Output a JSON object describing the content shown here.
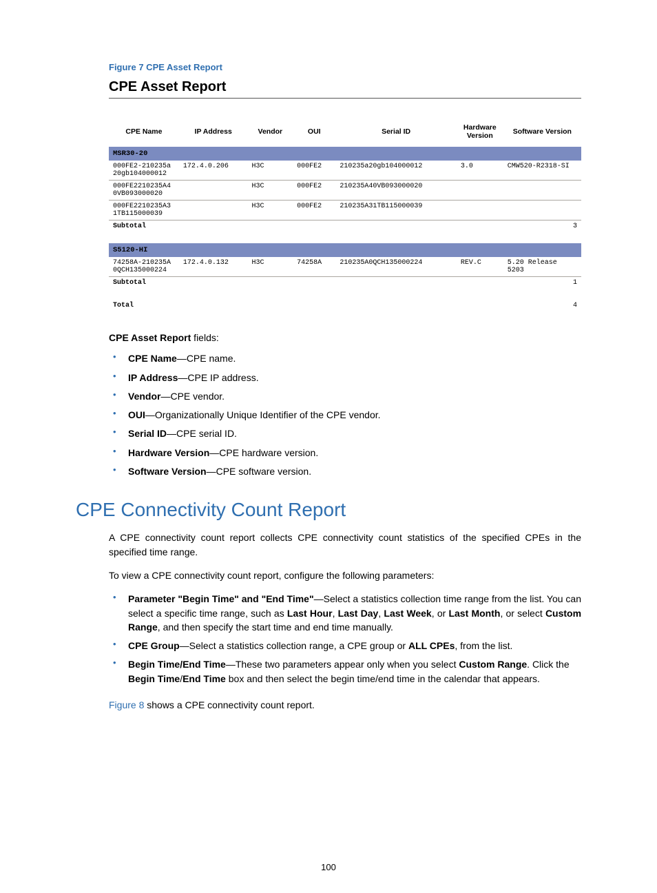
{
  "figure": {
    "caption": "Figure 7 CPE Asset Report"
  },
  "report": {
    "title": "CPE Asset Report",
    "columns": [
      "CPE Name",
      "IP Address",
      "Vendor",
      "OUI",
      "Serial ID",
      "Hardware Version",
      "Software Version"
    ],
    "groups": [
      {
        "name": "MSR30-20",
        "rows": [
          {
            "name": "000FE2-210235a20gb104000012",
            "ip": "172.4.0.206",
            "vendor": "H3C",
            "oui": "000FE2",
            "serial": "210235a20gb104000012",
            "hw": "3.0",
            "sw": "CMW520-R2318-SI"
          },
          {
            "name": "000FE2210235A40VB093000020",
            "ip": "",
            "vendor": "H3C",
            "oui": "000FE2",
            "serial": "210235A40VB093000020",
            "hw": "",
            "sw": ""
          },
          {
            "name": "000FE2210235A31TB115000039",
            "ip": "",
            "vendor": "H3C",
            "oui": "000FE2",
            "serial": "210235A31TB115000039",
            "hw": "",
            "sw": ""
          }
        ],
        "subtotal_label": "Subtotal",
        "subtotal": "3"
      },
      {
        "name": "S5120-HI",
        "rows": [
          {
            "name": "74258A-210235A0QCH135000224",
            "ip": "172.4.0.132",
            "vendor": "H3C",
            "oui": "74258A",
            "serial": "210235A0QCH135000224",
            "hw": "REV.C",
            "sw": "5.20 Release 5203"
          }
        ],
        "subtotal_label": "Subtotal",
        "subtotal": "1"
      }
    ],
    "total_label": "Total",
    "total": "4"
  },
  "fields": {
    "intro_bold": "CPE Asset Report",
    "intro_rest": " fields:",
    "items": [
      {
        "term": "CPE Name",
        "desc": "—CPE name."
      },
      {
        "term": "IP Address",
        "desc": "—CPE IP address."
      },
      {
        "term": "Vendor",
        "desc": "—CPE vendor."
      },
      {
        "term": "OUI",
        "desc": "—Organizationally Unique Identifier of the CPE vendor."
      },
      {
        "term": "Serial ID",
        "desc": "—CPE serial ID."
      },
      {
        "term": "Hardware Version",
        "desc": "—CPE hardware version."
      },
      {
        "term": "Software Version",
        "desc": "—CPE software version."
      }
    ]
  },
  "section": {
    "heading": "CPE Connectivity Count Report",
    "para1": "A CPE connectivity count report collects CPE connectivity count statistics of the specified CPEs in the specified time range.",
    "para2": "To view a CPE connectivity count report, configure the following parameters:",
    "items": [
      {
        "term": "Parameter \"Begin Time\" and \"End Time\"",
        "desc_before": "—Select a statistics collection time range from the list. You can select a specific time range, such as ",
        "bolds": [
          "Last Hour",
          "Last Day",
          "Last Week",
          "Last Month"
        ],
        "join1": ", ",
        "join2": ", ",
        "join3": ", or ",
        "desc_mid": ", or select ",
        "bold_last": "Custom Range",
        "desc_after": ", and then specify the start time and end time manually."
      },
      {
        "term": "CPE Group",
        "desc_before": "—Select a statistics collection range, a CPE group or ",
        "bold_last": "ALL CPEs",
        "desc_after": ", from the list."
      },
      {
        "term": "Begin Time/End Time",
        "desc_before": "—These two parameters appear only when you select ",
        "bold_mid": "Custom Range",
        "desc_mid2": ". Click the ",
        "bold_a": "Begin Time",
        "slash": "/",
        "bold_b": "End Time",
        "desc_after": " box and then select the begin time/end time in the calendar that appears."
      }
    ],
    "ref_link": "Figure 8",
    "ref_rest": " shows a CPE connectivity count report."
  },
  "page_number": "100"
}
